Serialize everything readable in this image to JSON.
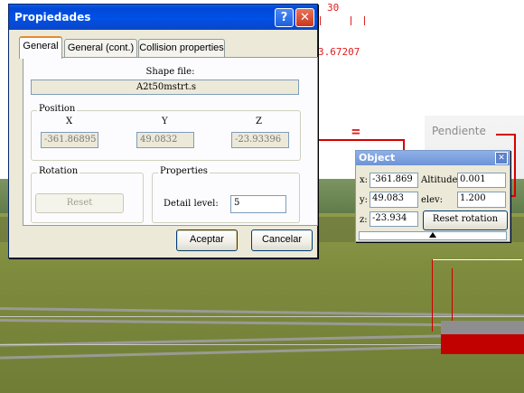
{
  "scene": {
    "top_label": "30",
    "side_value": "3.67207",
    "equals_mark": "=",
    "pendiente_label": "Pendiente"
  },
  "propiedades": {
    "title": "Propiedades",
    "help_glyph": "?",
    "close_glyph": "✕",
    "tabs": [
      {
        "label": "General"
      },
      {
        "label": "General (cont.)"
      },
      {
        "label": "Collision properties"
      }
    ],
    "shape_file_label": "Shape file:",
    "shape_file_value": "A2t50mstrt.s",
    "position": {
      "group_label": "Position",
      "x_label": "X",
      "y_label": "Y",
      "z_label": "Z",
      "x_value": "-361.86895",
      "y_value": "49.0832",
      "z_value": "-23.93396"
    },
    "rotation": {
      "group_label": "Rotation",
      "reset_label": "Reset"
    },
    "properties": {
      "group_label": "Properties",
      "detail_label": "Detail level:",
      "detail_value": "5"
    },
    "accept_label": "Aceptar",
    "cancel_label": "Cancelar"
  },
  "object_panel": {
    "title": "Object",
    "close_glyph": "✕",
    "x_label": "x:",
    "x_value": "-361.869",
    "y_label": "y:",
    "y_value": "49.083",
    "z_label": "z:",
    "z_value": "-23.934",
    "altitude_label": "Altitude",
    "altitude_value": "0.001",
    "elev_label": "elev:",
    "elev_value": "1.200",
    "reset_rotation_label": "Reset rotation"
  },
  "colors": {
    "titlebar": "#0050e6",
    "annotation_red": "#d60000"
  }
}
